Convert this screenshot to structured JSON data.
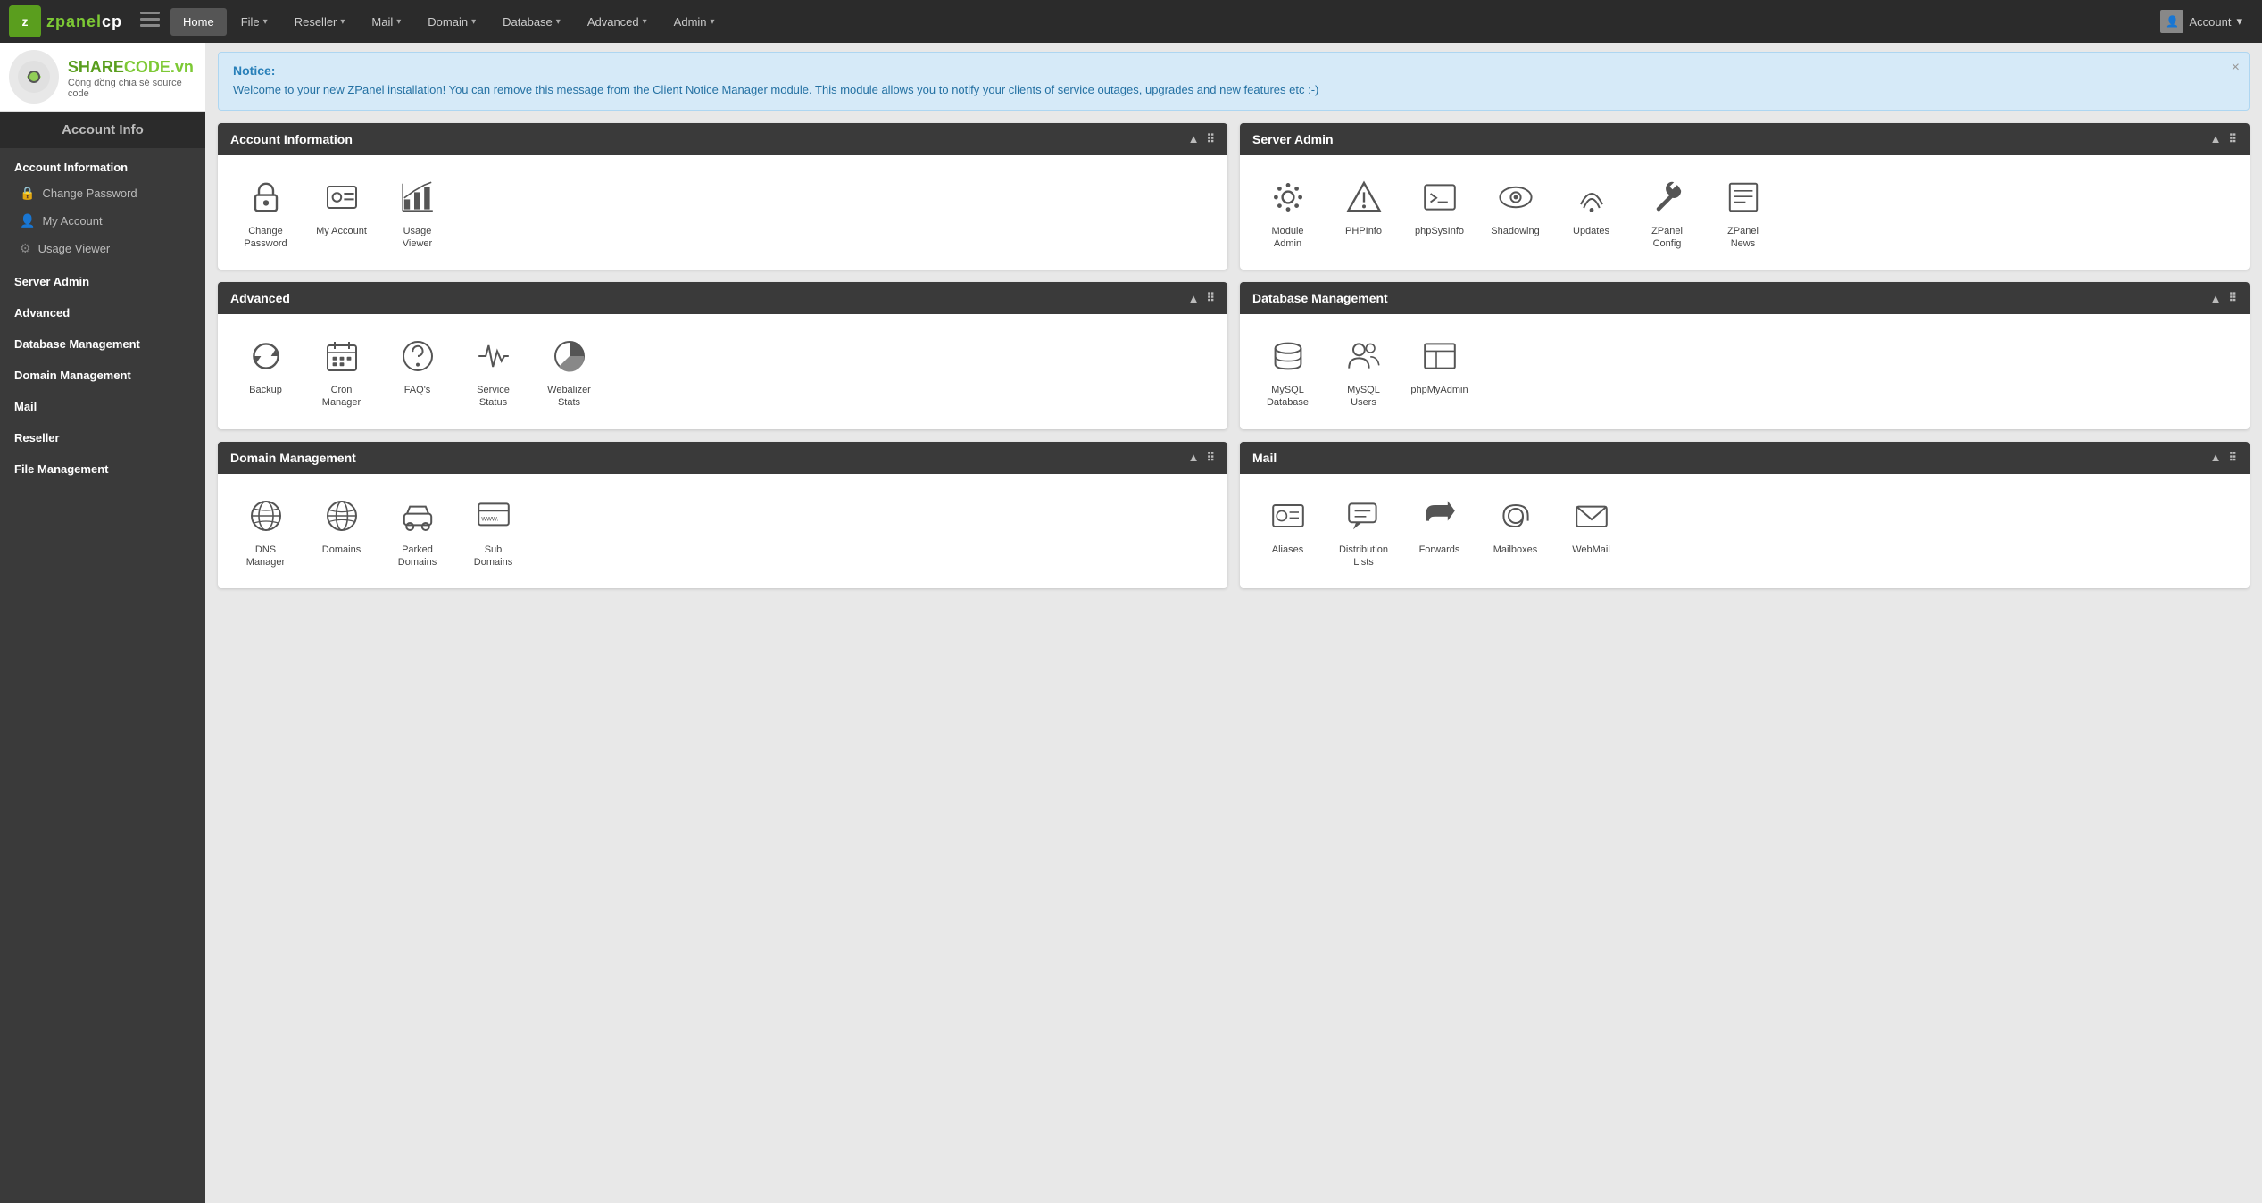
{
  "app": {
    "logo_z": "z",
    "logo_name": "zpanelcp",
    "logo_name_highlight": "cp"
  },
  "nav": {
    "bars_icon": "≡",
    "items": [
      {
        "label": "Home",
        "active": true,
        "has_arrow": false
      },
      {
        "label": "File",
        "active": false,
        "has_arrow": true
      },
      {
        "label": "Reseller",
        "active": false,
        "has_arrow": true
      },
      {
        "label": "Mail",
        "active": false,
        "has_arrow": true
      },
      {
        "label": "Domain",
        "active": false,
        "has_arrow": true
      },
      {
        "label": "Database",
        "active": false,
        "has_arrow": true
      },
      {
        "label": "Advanced",
        "active": false,
        "has_arrow": true
      },
      {
        "label": "Admin",
        "active": false,
        "has_arrow": true
      }
    ],
    "account_label": "Account"
  },
  "sidebar": {
    "header": "Account Info",
    "sections": [
      {
        "title": "Account Information",
        "items": [
          {
            "label": "Change Password",
            "icon": "🔒"
          },
          {
            "label": "My Account",
            "icon": "👤"
          },
          {
            "label": "Usage Viewer",
            "icon": "⚙"
          }
        ]
      },
      {
        "title": "Server Admin",
        "items": []
      },
      {
        "title": "Advanced",
        "items": []
      },
      {
        "title": "Database Management",
        "items": []
      },
      {
        "title": "Domain Management",
        "items": []
      },
      {
        "title": "Mail",
        "items": []
      },
      {
        "title": "Reseller",
        "items": []
      },
      {
        "title": "File Management",
        "items": []
      }
    ]
  },
  "sharecode": {
    "title_share": "SHARE",
    "title_code": "CODE",
    "title_vn": ".vn",
    "subtitle": "Cộng đồng chia sẻ source code"
  },
  "notice": {
    "title": "Notice:",
    "text": "Welcome to your new ZPanel installation! You can remove this message from the Client Notice Manager module. This module allows you to notify your clients of service outages, upgrades and new features etc :-)",
    "close": "×"
  },
  "panels": [
    {
      "id": "account-information",
      "title": "Account Information",
      "items": [
        {
          "label": "Change Password",
          "icon_type": "lock"
        },
        {
          "label": "My Account",
          "icon_type": "person"
        },
        {
          "label": "Usage Viewer",
          "icon_type": "chart"
        }
      ]
    },
    {
      "id": "server-admin",
      "title": "Server Admin",
      "items": [
        {
          "label": "Module Admin",
          "icon_type": "gear"
        },
        {
          "label": "PHPInfo",
          "icon_type": "warning"
        },
        {
          "label": "phpSysInfo",
          "icon_type": "terminal"
        },
        {
          "label": "Shadowing",
          "icon_type": "eye"
        },
        {
          "label": "Updates",
          "icon_type": "broadcast"
        },
        {
          "label": "ZPanel Config",
          "icon_type": "wrench"
        },
        {
          "label": "ZPanel News",
          "icon_type": "news"
        }
      ]
    },
    {
      "id": "advanced",
      "title": "Advanced",
      "items": [
        {
          "label": "Backup",
          "icon_type": "refresh"
        },
        {
          "label": "Cron Manager",
          "icon_type": "calendar"
        },
        {
          "label": "FAQ's",
          "icon_type": "question"
        },
        {
          "label": "Service Status",
          "icon_type": "pulse"
        },
        {
          "label": "Webalizer Stats",
          "icon_type": "piechart"
        }
      ]
    },
    {
      "id": "database-management",
      "title": "Database Management",
      "items": [
        {
          "label": "MySQL Database",
          "icon_type": "database"
        },
        {
          "label": "MySQL Users",
          "icon_type": "users"
        },
        {
          "label": "phpMyAdmin",
          "icon_type": "phpmyadmin"
        }
      ]
    },
    {
      "id": "domain-management",
      "title": "Domain Management",
      "items": [
        {
          "label": "DNS Manager",
          "icon_type": "globe"
        },
        {
          "label": "Domains",
          "icon_type": "globe2"
        },
        {
          "label": "Parked Domains",
          "icon_type": "car"
        },
        {
          "label": "Sub Domains",
          "icon_type": "www"
        }
      ]
    },
    {
      "id": "mail",
      "title": "Mail",
      "items": [
        {
          "label": "Aliases",
          "icon_type": "vcard"
        },
        {
          "label": "Distribution Lists",
          "icon_type": "chat"
        },
        {
          "label": "Forwards",
          "icon_type": "forward"
        },
        {
          "label": "Mailboxes",
          "icon_type": "at"
        },
        {
          "label": "WebMail",
          "icon_type": "envelope"
        }
      ]
    }
  ]
}
